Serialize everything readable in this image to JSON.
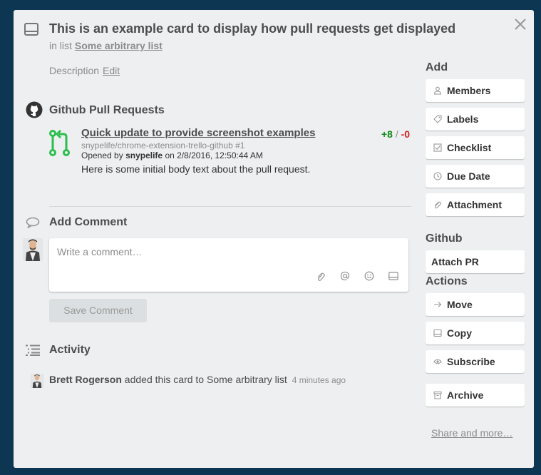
{
  "card": {
    "title": "This is an example card to display how pull requests get displayed",
    "in_list_prefix": "in list",
    "list_name": "Some arbitrary list",
    "description_label": "Description",
    "edit_link": "Edit"
  },
  "github_section": {
    "heading": "Github Pull Requests",
    "pr": {
      "title": "Quick update to provide screenshot examples",
      "repo": "snypelife/chrome-extension-trello-github #1",
      "opened_prefix": "Opened by",
      "author": "snypelife",
      "opened_suffix": "on 2/8/2016, 12:50:44 AM",
      "body": "Here is some initial body text about the pull request.",
      "additions": "+8",
      "separator": "/",
      "deletions": "-0"
    }
  },
  "comment": {
    "heading": "Add Comment",
    "placeholder": "Write a comment…",
    "save_label": "Save Comment"
  },
  "activity": {
    "heading": "Activity",
    "user": "Brett Rogerson",
    "action": "added this card to Some arbitrary list",
    "time": "4 minutes ago"
  },
  "sidebar": {
    "add_heading": "Add",
    "add_buttons": [
      "Members",
      "Labels",
      "Checklist",
      "Due Date",
      "Attachment"
    ],
    "github_heading": "Github",
    "attach_pr": "Attach PR",
    "actions_heading": "Actions",
    "action_buttons": [
      "Move",
      "Copy",
      "Subscribe",
      "Archive"
    ],
    "share_link": "Share and more…"
  },
  "colors": {
    "backdrop": "#0d3652",
    "card_bg": "#edeff0",
    "additions": "#0e8a16",
    "deletions": "#d81b1b",
    "pr_icon": "#2cbe4e"
  }
}
